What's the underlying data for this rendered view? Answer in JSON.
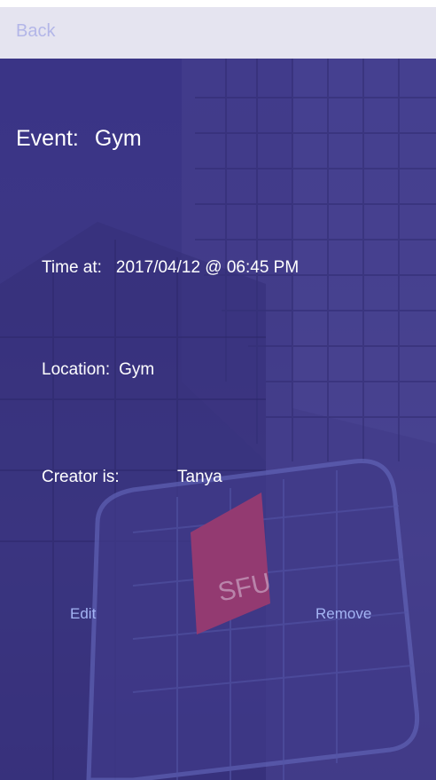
{
  "nav": {
    "back_label": "Back"
  },
  "event": {
    "label": "Event:",
    "value": "Gym"
  },
  "details": {
    "time_label": "Time at:",
    "time_value": "2017/04/12 @ 06:45 PM",
    "location_label": "Location:",
    "location_value": "Gym",
    "creator_label": "Creator is:",
    "creator_value": "Tanya"
  },
  "actions": {
    "edit_label": "Edit",
    "remove_label": "Remove"
  },
  "background": {
    "sign_text": "SFU",
    "tint_color": "#3a3480",
    "nav_color": "#e5e4f0",
    "link_color": "#a4b4f4",
    "sign_color": "#b13d6d"
  }
}
